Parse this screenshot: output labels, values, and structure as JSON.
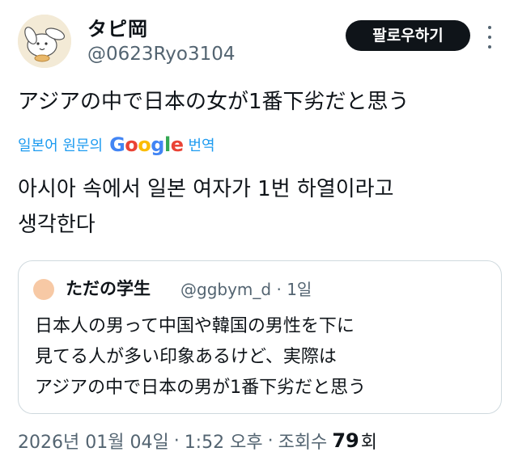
{
  "user": {
    "display_name": "タピ岡",
    "handle": "@0623Ryo3104",
    "follow_label": "팔로우하기",
    "avatar_icon": "cartoon-dog-avatar"
  },
  "tweet": {
    "text": "アジアの中で日本の女が1番下劣だと思う",
    "translate": {
      "prefix": "일본어 원문의",
      "provider": "Google",
      "suffix": "번역"
    },
    "translated_lines": [
      "아시아 속에서 일본 여자가 1번 하열이라고",
      "생각한다"
    ]
  },
  "quote": {
    "name": "ただの学生",
    "handle": "@ggbym_d",
    "separator": "·",
    "time": "1일",
    "lines": [
      "日本人の男って中国や韓国の男性を下に",
      "見てる人が多い印象あるけど、実際は",
      "アジアの中で日本の男が1番下劣だと思う"
    ]
  },
  "footer": {
    "date": "2026년 01월 04일",
    "separator": "·",
    "time": "1:52 오후",
    "views_label": "조회수",
    "views_count": "79",
    "views_unit": "회"
  },
  "colors": {
    "link": "#1d9bf0",
    "text": "#0f1419",
    "muted": "#536471",
    "border": "#cfd9de",
    "google_blue": "#4285f4",
    "google_red": "#ea4335",
    "google_yellow": "#fbbc05",
    "google_green": "#34a853"
  }
}
